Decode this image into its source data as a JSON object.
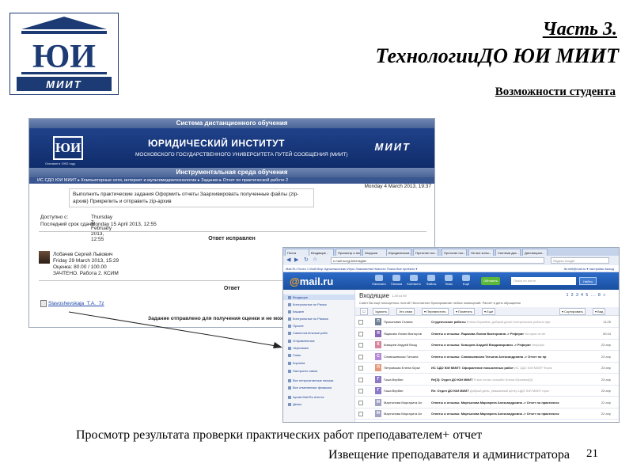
{
  "slide": {
    "title_line1": "Часть 3.",
    "title_line2": "ТехнологииДО  ЮИ  МИИТ",
    "subtitle": "Возможности студента",
    "caption_line1": "Просмотр результата  проверки практических  работ  преподавателем+ отчет",
    "caption_line2": "Извещение преподавателя и администратора",
    "page_number": "21",
    "logo_letters": "ЮИ",
    "logo_wordmark": "МИИТ"
  },
  "lms": {
    "top_bar": "Система дистанционного обучения",
    "logo_letters": "ЮИ",
    "logo_caption": "Основан в 1992 году",
    "institute_title": "ЮРИДИЧЕСКИЙ ИНСТИТУТ",
    "institute_subtitle": "МОСКОВСКОГО ГОСУДАРСТВЕННОГО УНИВЕРСИТЕТА ПУТЕЙ СООБЩЕНИЯ (МИИТ)",
    "miit_logo": "МИИТ",
    "tool_bar": "Инструментальная среда обучения",
    "breadcrumb": "ИС СДО ЮИ МИИТ  ▸ Компьютерные сети, интернет и мультимедиатехнологии ▸ Задания ▸ Отчет по практической работе 2",
    "date": "Monday 4 March 2013, 19:37",
    "task_text": "Выполнить практические задания Оформить отчеты Заархивировать полученные файлы (zip-архив) Прикрепить и отправить zip-архив",
    "available_label": "Доступно с:",
    "available_value": "Thursday 7 February 2013, 12:55",
    "due_label": "Последний срок сдачи:",
    "due_value": "Monday 15 April 2013, 12:55",
    "graded_header": "Ответ исправлен",
    "teacher_name": "Лобачев Сергей Львович",
    "teacher_date": "Friday 29 March 2013, 15:29",
    "grade_text": "Оценка: 80.00 / 100.00",
    "status_text": "ЗАЧТЕНО. Работа 2. КСИМ",
    "answer_header": "Ответ",
    "file_name": "Slavoshevskaja_T.A._7z",
    "submitted_text": "Задание отправлено для получения оценки и не может б"
  },
  "mail": {
    "tabs": [
      "Почта",
      "Входящие -",
      "Просмотр и нес...",
      "Загрузки",
      "Юридическом...",
      "Прототип пог...",
      "Прототип пог...",
      "Не все копы...",
      "Система дис...",
      "Дистанцион..."
    ],
    "url": "e.mail.ru/cgi-bin/msglist",
    "browser_search_placeholder": "Яндекс.Google",
    "portal_links": "Mail.Ru   Почта 1   Мой Мир   Одноклассники   Игры   Знакомства   Новости   Поиск   Все проекты ▾",
    "user_links": "tkr.miit@mail.ru ▾   настройки   выход",
    "logo_at": "@",
    "logo_text": "mail.ru",
    "nav": [
      "Написать",
      "Письма",
      "Контакты",
      "Файлы",
      "Темы",
      "Ещё"
    ],
    "btn_green": "Обновить",
    "search_placeholder": "Поиск по почте",
    "search_button": "Найти",
    "folders": [
      "Входящие",
      "Контрольные по Римск",
      "Кашкин",
      "Контрольные по Римско",
      "Прочее",
      "Самостоятельные рабо",
      "Отправленные",
      "Черновики",
      "Спам",
      "Корзина",
      "Настроить папки",
      "Все непрочитанные письма",
      "Все отмеченные флажком",
      "Архив Mail.Ru Агента",
      "Денис"
    ],
    "inbox_title": "Входящие",
    "inbox_count": "1-49 из 59",
    "pages": "1  2  3  4  5  ...  8  »",
    "notice": "Совет  Вы ещё пользуетесь почтой?  Бесплатное бронирование любых помещений. Расчёт в день обращения",
    "toolbar": [
      "Удалить",
      "Это спам",
      "▾ Переместить",
      "▾ Пометить",
      "▾ Ещё",
      "▾ Сортировать",
      "▾ Вид"
    ],
    "rows": [
      {
        "from": "Прокопович Галина",
        "subject": "Студенческие работы",
        "preview": "Елена Юрьевна, добрый день! Контрольные работы при",
        "date": "11:25",
        "color": "#6f7f98"
      },
      {
        "from": "Ящикова Лилия Викторов",
        "subject": "Ответы и отзывы: Ящикова Лилия Викторовна -> Реферат",
        "preview": "История отчет",
        "date": "00:44",
        "color": "#8a68b8"
      },
      {
        "from": "Ковырев Андрей Влад",
        "subject": "Ответы и отзывы: Ковырев Андрей Владимирович -> Реферат",
        "preview": "Информ",
        "date": "23 апр",
        "color": "#d7849c"
      },
      {
        "from": "Славошевская Татьяна",
        "subject": "Ответы и отзывы: Славошевская Татьяна Александровна -> Отчет по пр",
        "preview": "",
        "date": "23 апр",
        "color": "#b58ad8"
      },
      {
        "from": "Петровская Елена Юрье",
        "subject": "ИС СДО ЮИ МИИТ: Оформление письменных работ",
        "preview": "ИС СДО ЮИ МИИТ Форм",
        "date": "23 апр",
        "color": "#e29a7e"
      },
      {
        "from": "Гоша Вербин",
        "subject": "Re[3]: Отдел ДО ЮИ МИИТ",
        "preview": "Я все понял спасибо Елена Юрьевна[3]",
        "date": "23 апр",
        "color": "#8c7ac8"
      },
      {
        "from": "Гоша Вербин",
        "subject": "Re: Отдел ДО ЮИ МИИТ",
        "preview": "Добрый день, уважаемый центр ЦДО ЮИ МИИТ прос",
        "date": "23 апр",
        "color": "#8c7ac8"
      },
      {
        "from": "Мартынова Маргарита Ал",
        "subject": "Ответы и отзывы: Мартынова Маргарита Александровна -> Отчет по практическ",
        "preview": "",
        "date": "22 апр",
        "color": "#a2a2c6"
      },
      {
        "from": "Мартынова Маргарита Ал",
        "subject": "Ответы и отзывы: Мартынова Маргарита Александровна -> Отчет по практическ",
        "preview": "",
        "date": "22 апр",
        "color": "#a2a2c6"
      }
    ]
  }
}
